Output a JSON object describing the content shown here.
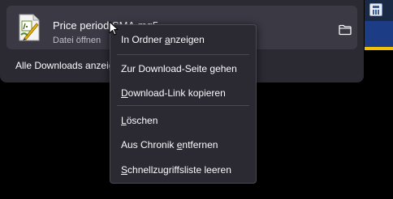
{
  "download": {
    "file_name": "Price period SMA.mq5",
    "status": "Datei öffnen",
    "all_downloads_label": "Alle Downloads anzeigen"
  },
  "menu": {
    "items": [
      {
        "pre": "In Ordner ",
        "acc": "a",
        "post": "nzeigen"
      },
      {
        "pre": "Zur Download-Seite ",
        "acc": "g",
        "post": "ehen"
      },
      {
        "pre": "",
        "acc": "D",
        "post": "ownload-Link kopieren"
      },
      {
        "pre": "",
        "acc": "L",
        "post": "öschen"
      },
      {
        "pre": "Aus Chronik ",
        "acc": "e",
        "post": "ntfernen"
      },
      {
        "pre": "",
        "acc": "S",
        "post": "chnellzugriffsliste leeren"
      }
    ]
  },
  "icons": {
    "file": "mq5-file-icon",
    "folder": "folder-icon",
    "cursor": "mouse-pointer-icon",
    "calculator": "calculator-icon"
  },
  "colors": {
    "panel_bg": "#2b2a33",
    "item_bg": "#3a3944",
    "text": "#fbfbfe",
    "subtext": "#bfbfc9"
  }
}
